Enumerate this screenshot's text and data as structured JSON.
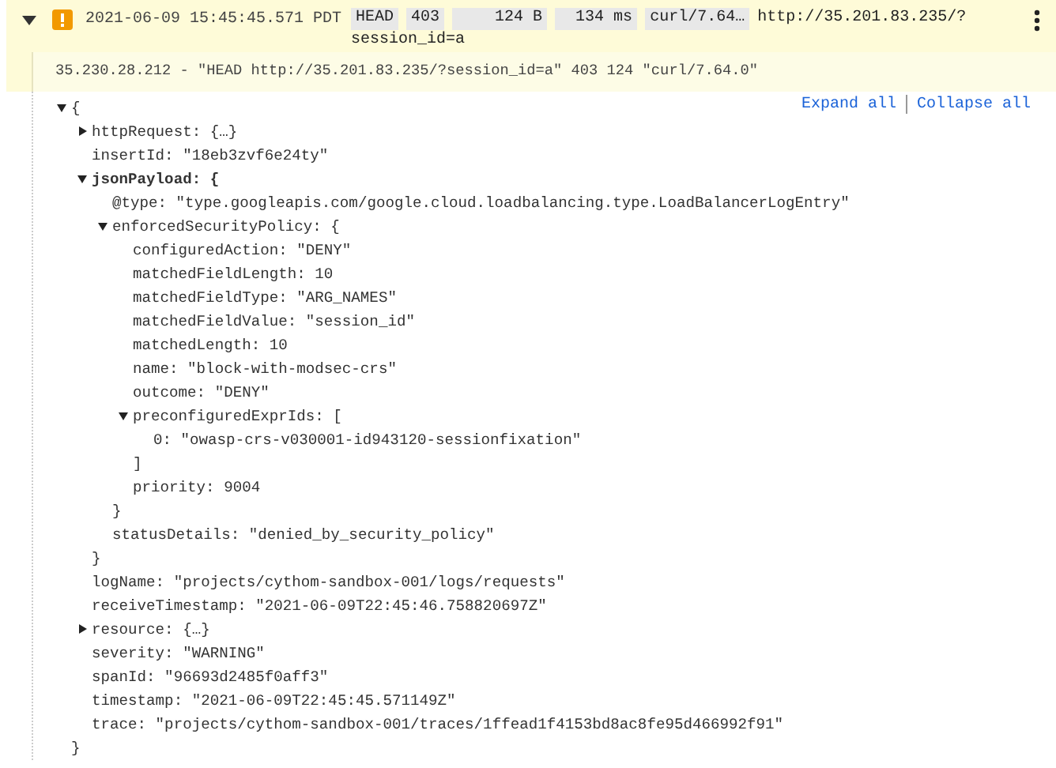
{
  "entry": {
    "expanded": true,
    "timestamp": "2021-06-09 15:45:45.571 PDT",
    "chips": [
      "HEAD",
      "403",
      "124 B",
      "134 ms",
      "curl/7.64…"
    ],
    "url_lines": [
      "http://35.201.83.235/?",
      "session_id=a"
    ],
    "summary": "35.230.28.212 - \"HEAD http://35.201.83.235/?session_id=a\" 403 124 \"curl/7.64.0\""
  },
  "actions": [
    "Expand all",
    "Collapse all"
  ],
  "tree": {
    "kind": "branch",
    "open": "{",
    "close": "}",
    "expanded": true,
    "children": [
      {
        "kind": "branch",
        "key": "httpRequest:",
        "open": "{…}",
        "expanded": false
      },
      {
        "kind": "leaf",
        "key": "insertId:",
        "value": "\"18eb3zvf6e24ty\""
      },
      {
        "kind": "branch",
        "key": "jsonPayload:",
        "open": "{",
        "close": "}",
        "expanded": true,
        "children": [
          {
            "kind": "leaf",
            "key": "@type:",
            "value": "\"type.googleapis.com/google.cloud.loadbalancing.type.LoadBalancerLogEntry\""
          },
          {
            "kind": "branch",
            "key": "enforcedSecurityPolicy:",
            "open": "{",
            "close": "}",
            "expanded": true,
            "children": [
              {
                "kind": "leaf",
                "key": "configuredAction:",
                "value": "\"DENY\""
              },
              {
                "kind": "leaf",
                "key": "matchedFieldLength:",
                "value": "10"
              },
              {
                "kind": "leaf",
                "key": "matchedFieldType:",
                "value": "\"ARG_NAMES\""
              },
              {
                "kind": "leaf",
                "key": "matchedFieldValue:",
                "value": "\"session_id\""
              },
              {
                "kind": "leaf",
                "key": "matchedLength:",
                "value": "10"
              },
              {
                "kind": "leaf",
                "key": "name:",
                "value": "\"block-with-modsec-crs\""
              },
              {
                "kind": "leaf",
                "key": "outcome:",
                "value": "\"DENY\""
              },
              {
                "kind": "branch",
                "key": "preconfiguredExprIds:",
                "open": "[",
                "close": "]",
                "expanded": true,
                "children": [
                  {
                    "kind": "leaf",
                    "key": "0:",
                    "value": "\"owasp-crs-v030001-id943120-sessionfixation\""
                  }
                ]
              },
              {
                "kind": "leaf",
                "key": "priority:",
                "value": "9004"
              }
            ]
          },
          {
            "kind": "leaf",
            "key": "statusDetails:",
            "value": "\"denied_by_security_policy\""
          }
        ]
      },
      {
        "kind": "leaf",
        "key": "logName:",
        "value": "\"projects/cythom-sandbox-001/logs/requests\""
      },
      {
        "kind": "leaf",
        "key": "receiveTimestamp:",
        "value": "\"2021-06-09T22:45:46.758820697Z\""
      },
      {
        "kind": "branch",
        "key": "resource:",
        "open": "{…}",
        "expanded": false
      },
      {
        "kind": "leaf",
        "key": "severity:",
        "value": "\"WARNING\""
      },
      {
        "kind": "leaf",
        "key": "spanId:",
        "value": "\"96693d2485f0aff3\""
      },
      {
        "kind": "leaf",
        "key": "timestamp:",
        "value": "\"2021-06-09T22:45:45.571149Z\""
      },
      {
        "kind": "leaf",
        "key": "trace:",
        "value": "\"projects/cythom-sandbox-001/traces/1ffead1f4153bd8ac8fe95d466992f91\""
      }
    ]
  }
}
